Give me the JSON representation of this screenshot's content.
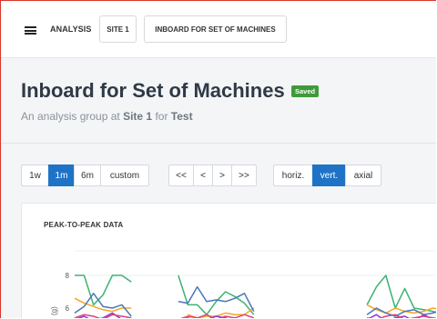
{
  "nav": {
    "breadcrumbs": [
      "ANALYSIS",
      "SITE 1",
      "INBOARD FOR SET OF MACHINES"
    ]
  },
  "header": {
    "title": "Inboard for Set of Machines",
    "status": "Saved",
    "subtitle_prefix": "An analysis group at",
    "site": "Site 1",
    "for_word": "for",
    "target": "Test"
  },
  "controls": {
    "ranges": [
      "1w",
      "1m",
      "6m",
      "custom"
    ],
    "active_range": "1m",
    "navigation": [
      "<<",
      "<",
      ">",
      ">>"
    ],
    "axes": [
      "horiz.",
      "vert.",
      "axial"
    ],
    "active_axis": "vert."
  },
  "chart": {
    "title": "PEAK-TO-PEAK DATA",
    "y_axis_label": "(g)"
  },
  "colors": {
    "accent": "#1f73c6",
    "saved": "#3f9b3a",
    "frame": "#d9342b"
  },
  "chart_data": {
    "type": "line",
    "title": "PEAK-TO-PEAK DATA",
    "ylabel": "(g)",
    "yticks": [
      8,
      6
    ],
    "ylim": [
      4.5,
      8.5
    ],
    "x": [
      0,
      1,
      2,
      3,
      4,
      5,
      6,
      7,
      8,
      9,
      10,
      11,
      12,
      13,
      14,
      15,
      16,
      17,
      18,
      19,
      20,
      21,
      22,
      23,
      24,
      25,
      26,
      27,
      28,
      29,
      30,
      31,
      32,
      33,
      34,
      35,
      36,
      37,
      38,
      39
    ],
    "series": [
      {
        "color": "#3cb371",
        "values": [
          8,
          8,
          6.2,
          6.8,
          8,
          8,
          7.6,
          null,
          null,
          null,
          null,
          8,
          6.2,
          6.2,
          5.6,
          6.4,
          7.0,
          6.7,
          6.3,
          5.6,
          null,
          null,
          null,
          null,
          null,
          null,
          null,
          null,
          null,
          null,
          null,
          6.2,
          7.3,
          8,
          6.0,
          7.2,
          6.0,
          5.9,
          5.8,
          5.6
        ]
      },
      {
        "color": "#f5a623",
        "values": [
          6.6,
          6.3,
          6.1,
          5.9,
          5.8,
          6.0,
          6.0,
          null,
          null,
          null,
          null,
          null,
          5.6,
          5.4,
          5.5,
          5.5,
          5.7,
          5.6,
          5.6,
          6.0,
          null,
          null,
          null,
          null,
          null,
          null,
          null,
          null,
          null,
          null,
          null,
          6.2,
          5.9,
          5.7,
          6.0,
          5.8,
          5.7,
          5.8,
          6.0,
          5.9
        ]
      },
      {
        "color": "#4a78b5",
        "values": [
          5.7,
          6.1,
          6.9,
          6.1,
          6.0,
          6.2,
          5.5,
          null,
          null,
          null,
          null,
          6.4,
          6.3,
          7.3,
          6.4,
          6.5,
          6.4,
          6.6,
          6.9,
          5.8,
          null,
          null,
          null,
          null,
          null,
          null,
          null,
          null,
          null,
          null,
          null,
          5.6,
          6.0,
          5.7,
          5.5,
          5.8,
          5.9,
          5.6,
          5.7,
          5.9
        ]
      },
      {
        "color": "#9b30d0",
        "values": [
          5.3,
          5.5,
          5.2,
          5.4,
          5.7,
          5.3,
          5.2,
          null,
          null,
          null,
          null,
          5.2,
          5.4,
          5.2,
          5.3,
          5.5,
          5.4,
          5.2,
          5.3,
          5.2,
          null,
          null,
          null,
          null,
          null,
          null,
          null,
          null,
          null,
          null,
          null,
          5.3,
          5.6,
          5.2,
          5.4,
          5.5,
          5.2,
          5.6,
          5.3,
          5.5
        ]
      },
      {
        "color": "#e0407a",
        "values": [
          5.4,
          5.6,
          5.5,
          5.3,
          5.6,
          5.5,
          5.4,
          null,
          null,
          null,
          null,
          5.3,
          5.5,
          5.4,
          5.6,
          5.3,
          5.5,
          5.4,
          5.6,
          5.4,
          null,
          null,
          null,
          null,
          null,
          null,
          null,
          null,
          null,
          null,
          null,
          5.4,
          5.3,
          5.5,
          5.6,
          5.3,
          5.4,
          5.5,
          5.4,
          5.3
        ]
      }
    ]
  }
}
